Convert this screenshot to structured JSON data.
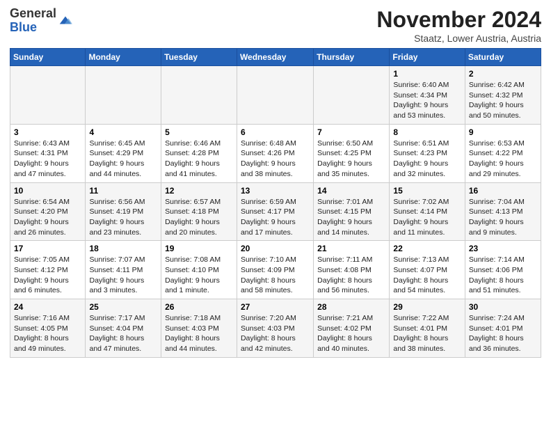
{
  "logo": {
    "general": "General",
    "blue": "Blue"
  },
  "header": {
    "month": "November 2024",
    "location": "Staatz, Lower Austria, Austria"
  },
  "days_of_week": [
    "Sunday",
    "Monday",
    "Tuesday",
    "Wednesday",
    "Thursday",
    "Friday",
    "Saturday"
  ],
  "weeks": [
    [
      {
        "day": "",
        "detail": ""
      },
      {
        "day": "",
        "detail": ""
      },
      {
        "day": "",
        "detail": ""
      },
      {
        "day": "",
        "detail": ""
      },
      {
        "day": "",
        "detail": ""
      },
      {
        "day": "1",
        "detail": "Sunrise: 6:40 AM\nSunset: 4:34 PM\nDaylight: 9 hours and 53 minutes."
      },
      {
        "day": "2",
        "detail": "Sunrise: 6:42 AM\nSunset: 4:32 PM\nDaylight: 9 hours and 50 minutes."
      }
    ],
    [
      {
        "day": "3",
        "detail": "Sunrise: 6:43 AM\nSunset: 4:31 PM\nDaylight: 9 hours and 47 minutes."
      },
      {
        "day": "4",
        "detail": "Sunrise: 6:45 AM\nSunset: 4:29 PM\nDaylight: 9 hours and 44 minutes."
      },
      {
        "day": "5",
        "detail": "Sunrise: 6:46 AM\nSunset: 4:28 PM\nDaylight: 9 hours and 41 minutes."
      },
      {
        "day": "6",
        "detail": "Sunrise: 6:48 AM\nSunset: 4:26 PM\nDaylight: 9 hours and 38 minutes."
      },
      {
        "day": "7",
        "detail": "Sunrise: 6:50 AM\nSunset: 4:25 PM\nDaylight: 9 hours and 35 minutes."
      },
      {
        "day": "8",
        "detail": "Sunrise: 6:51 AM\nSunset: 4:23 PM\nDaylight: 9 hours and 32 minutes."
      },
      {
        "day": "9",
        "detail": "Sunrise: 6:53 AM\nSunset: 4:22 PM\nDaylight: 9 hours and 29 minutes."
      }
    ],
    [
      {
        "day": "10",
        "detail": "Sunrise: 6:54 AM\nSunset: 4:20 PM\nDaylight: 9 hours and 26 minutes."
      },
      {
        "day": "11",
        "detail": "Sunrise: 6:56 AM\nSunset: 4:19 PM\nDaylight: 9 hours and 23 minutes."
      },
      {
        "day": "12",
        "detail": "Sunrise: 6:57 AM\nSunset: 4:18 PM\nDaylight: 9 hours and 20 minutes."
      },
      {
        "day": "13",
        "detail": "Sunrise: 6:59 AM\nSunset: 4:17 PM\nDaylight: 9 hours and 17 minutes."
      },
      {
        "day": "14",
        "detail": "Sunrise: 7:01 AM\nSunset: 4:15 PM\nDaylight: 9 hours and 14 minutes."
      },
      {
        "day": "15",
        "detail": "Sunrise: 7:02 AM\nSunset: 4:14 PM\nDaylight: 9 hours and 11 minutes."
      },
      {
        "day": "16",
        "detail": "Sunrise: 7:04 AM\nSunset: 4:13 PM\nDaylight: 9 hours and 9 minutes."
      }
    ],
    [
      {
        "day": "17",
        "detail": "Sunrise: 7:05 AM\nSunset: 4:12 PM\nDaylight: 9 hours and 6 minutes."
      },
      {
        "day": "18",
        "detail": "Sunrise: 7:07 AM\nSunset: 4:11 PM\nDaylight: 9 hours and 3 minutes."
      },
      {
        "day": "19",
        "detail": "Sunrise: 7:08 AM\nSunset: 4:10 PM\nDaylight: 9 hours and 1 minute."
      },
      {
        "day": "20",
        "detail": "Sunrise: 7:10 AM\nSunset: 4:09 PM\nDaylight: 8 hours and 58 minutes."
      },
      {
        "day": "21",
        "detail": "Sunrise: 7:11 AM\nSunset: 4:08 PM\nDaylight: 8 hours and 56 minutes."
      },
      {
        "day": "22",
        "detail": "Sunrise: 7:13 AM\nSunset: 4:07 PM\nDaylight: 8 hours and 54 minutes."
      },
      {
        "day": "23",
        "detail": "Sunrise: 7:14 AM\nSunset: 4:06 PM\nDaylight: 8 hours and 51 minutes."
      }
    ],
    [
      {
        "day": "24",
        "detail": "Sunrise: 7:16 AM\nSunset: 4:05 PM\nDaylight: 8 hours and 49 minutes."
      },
      {
        "day": "25",
        "detail": "Sunrise: 7:17 AM\nSunset: 4:04 PM\nDaylight: 8 hours and 47 minutes."
      },
      {
        "day": "26",
        "detail": "Sunrise: 7:18 AM\nSunset: 4:03 PM\nDaylight: 8 hours and 44 minutes."
      },
      {
        "day": "27",
        "detail": "Sunrise: 7:20 AM\nSunset: 4:03 PM\nDaylight: 8 hours and 42 minutes."
      },
      {
        "day": "28",
        "detail": "Sunrise: 7:21 AM\nSunset: 4:02 PM\nDaylight: 8 hours and 40 minutes."
      },
      {
        "day": "29",
        "detail": "Sunrise: 7:22 AM\nSunset: 4:01 PM\nDaylight: 8 hours and 38 minutes."
      },
      {
        "day": "30",
        "detail": "Sunrise: 7:24 AM\nSunset: 4:01 PM\nDaylight: 8 hours and 36 minutes."
      }
    ]
  ]
}
